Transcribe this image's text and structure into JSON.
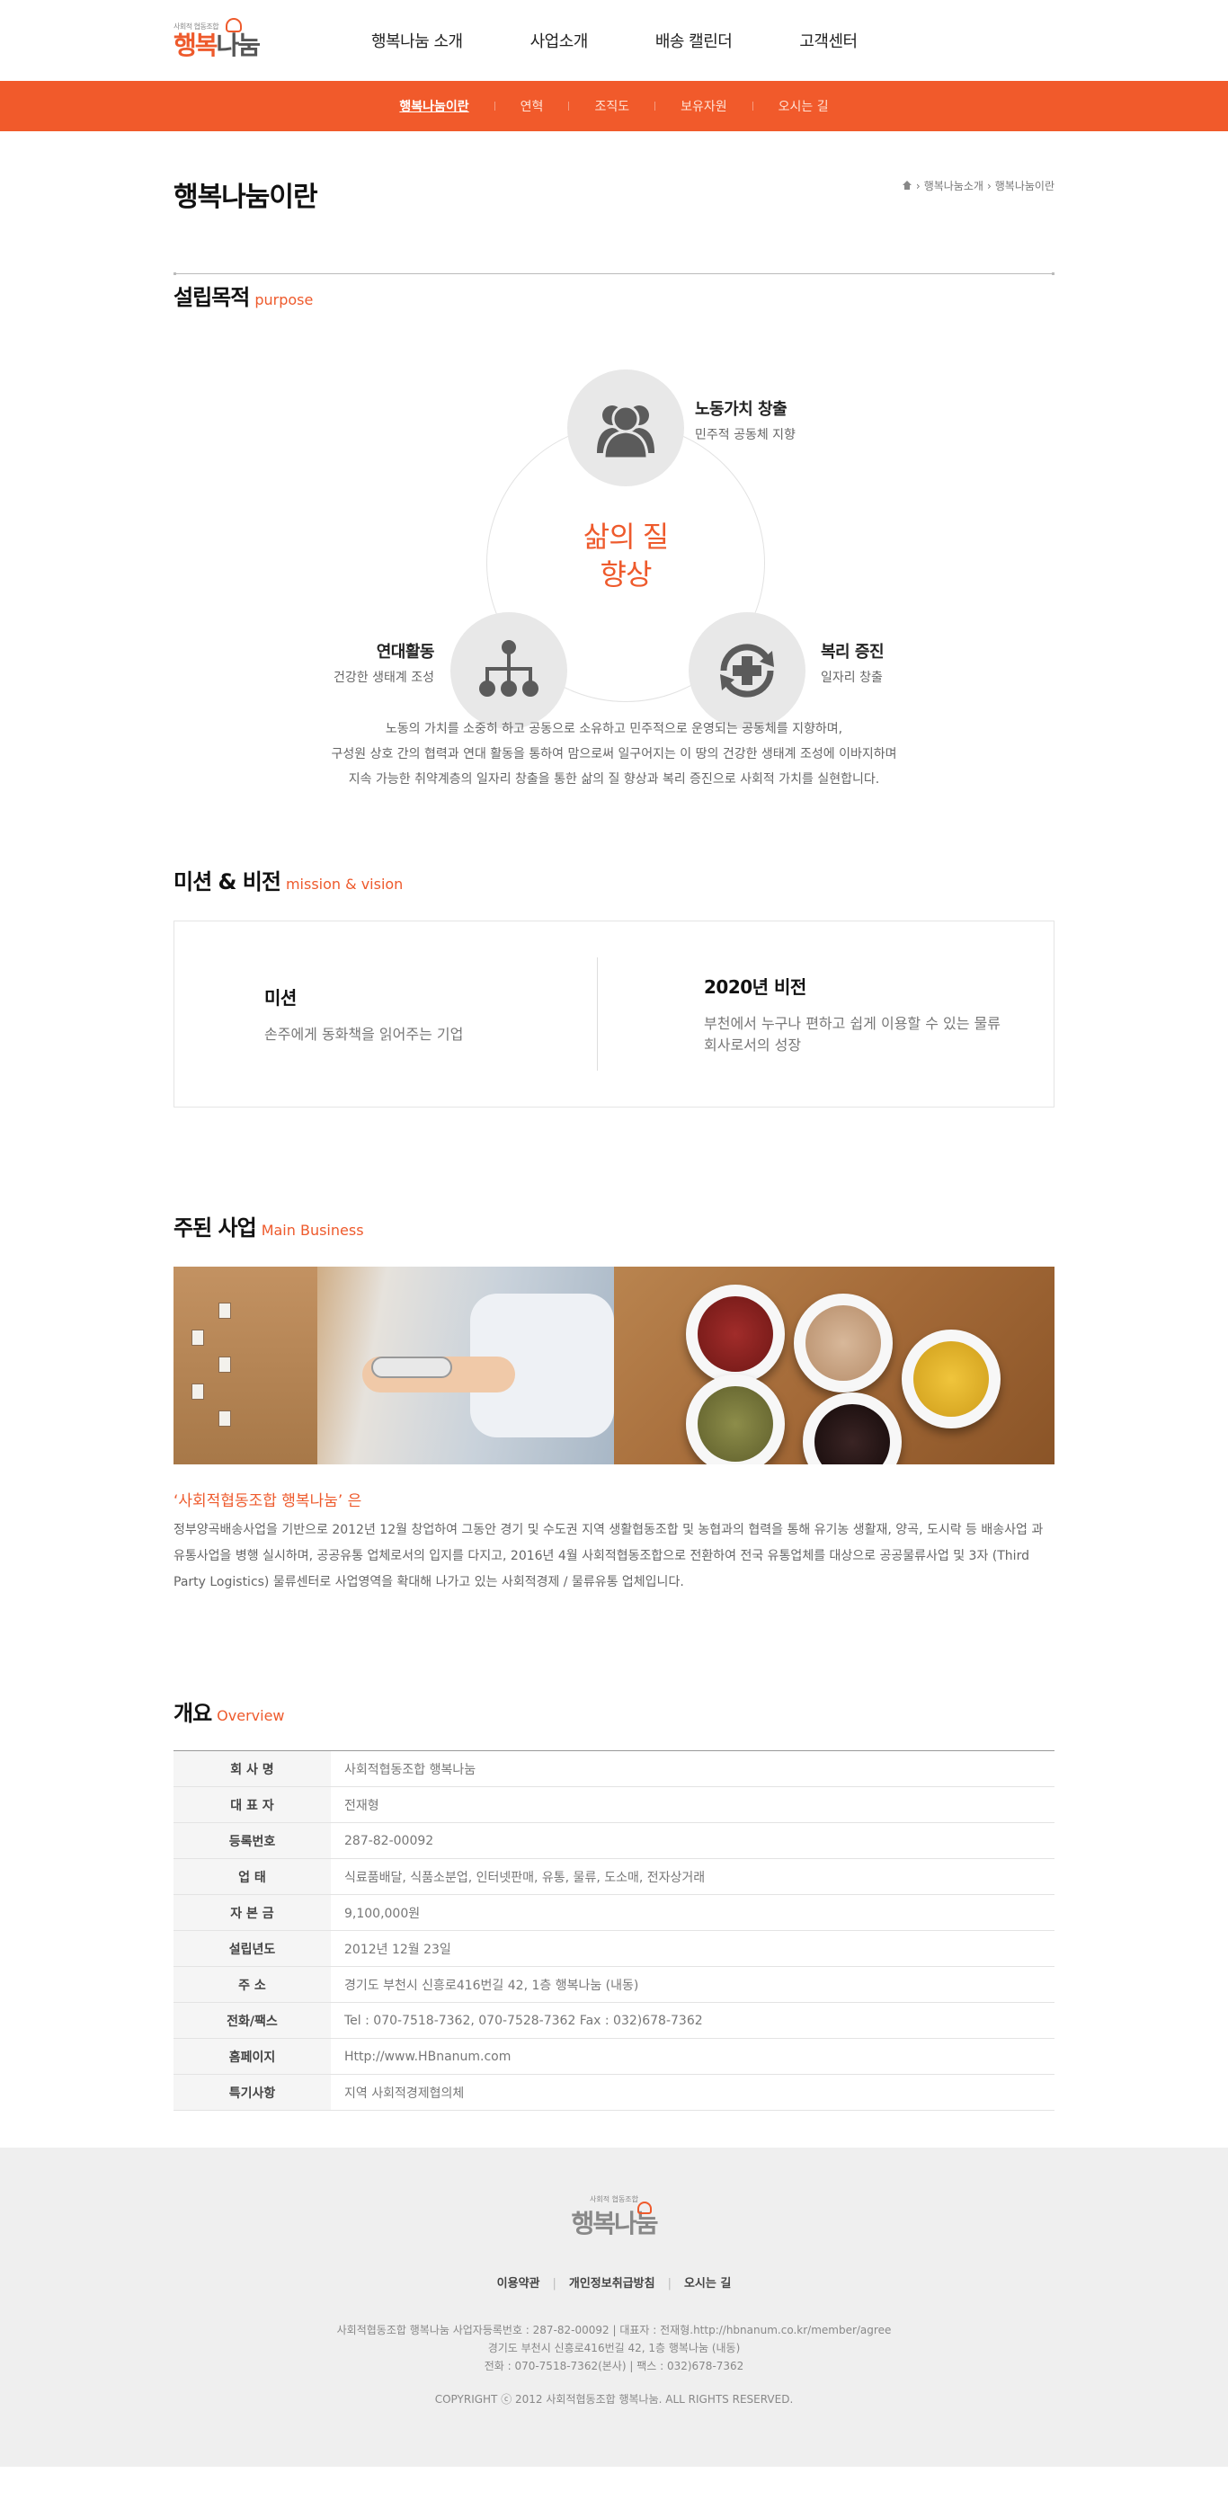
{
  "header": {
    "logo_small": "사회적 협동조합",
    "logo_main": "행복",
    "logo_main2": "나눔",
    "nav": [
      "행복나눔 소개",
      "사업소개",
      "배송 캘린더",
      "고객센터"
    ]
  },
  "subnav": [
    "행복나눔이란",
    "연혁",
    "조직도",
    "보유자원",
    "오시는 길"
  ],
  "page": {
    "title": "행복나눔이란",
    "breadcrumb": [
      "행복나눔소개",
      "행복나눔이란"
    ]
  },
  "purpose": {
    "heading": "설립목적",
    "heading_en": "purpose",
    "center_line1": "삶의 질",
    "center_line2": "향상",
    "nodes": [
      {
        "title": "노동가치 창출",
        "sub": "민주적 공동체 지향",
        "icon": "people-icon"
      },
      {
        "title": "연대활동",
        "sub": "건강한 생태계 조성",
        "icon": "org-chart-icon"
      },
      {
        "title": "복리 증진",
        "sub": "일자리 창출",
        "icon": "medical-cross-icon"
      }
    ],
    "desc": [
      "노동의 가치를 소중히 하고 공동으로 소유하고 민주적으로 운영되는 공동체를 지향하며,",
      "구성원 상호 간의 협력과 연대 활동을 통하여 맘으로써 일구어지는 이 땅의 건강한 생태계 조성에 이바지하며",
      "지속 가능한 취약계층의 일자리 창출을 통한 삶의 질 향상과 복리 증진으로 사회적 가치를 실현합니다."
    ]
  },
  "mission": {
    "heading": "미션 & 비전",
    "heading_en": "mission & vision",
    "mission_title": "미션",
    "mission_desc": "손주에게 동화책을 읽어주는 기업",
    "vision_title": "2020년 비전",
    "vision_desc": "부천에서 누구나 편하고 쉽게 이용할 수 있는 물류회사로서의 성장"
  },
  "business": {
    "heading": "주된 사업",
    "heading_en": "Main Business",
    "title": "‘사회적협동조합 행복나눔’ 은",
    "desc": "정부양곡배송사업을 기반으로 2012년 12월 창업하여 그동안 경기 및 수도권 지역 생활협동조합 및 농협과의 협력을 통해 유기농 생활재, 양곡, 도시락 등 배송사업 과 유통사업을 병행 실시하며, 공공유통 업체로서의 입지를 다지고, 2016년 4월 사회적협동조합으로 전환하여 전국 유통업체를 대상으로 공공물류사업 및 3자 (Third Party Logistics) 물류센터로 사업영역을 확대해 나가고 있는 사회적경제 / 물류유통 업체입니다."
  },
  "overview": {
    "heading": "개요",
    "heading_en": "Overview",
    "rows": [
      {
        "k": "회 사 명",
        "v": "사회적협동조합 행복나눔"
      },
      {
        "k": "대 표 자",
        "v": "전재형"
      },
      {
        "k": "등록번호",
        "v": "287-82-00092"
      },
      {
        "k": "업 태",
        "v": "식료품배달, 식품소분업, 인터넷판매, 유통, 물류, 도소매, 전자상거래"
      },
      {
        "k": "자 본 금",
        "v": "9,100,000원"
      },
      {
        "k": "설립년도",
        "v": "2012년 12월 23일"
      },
      {
        "k": "주 소",
        "v": "경기도 부천시 신흥로416번길 42, 1층 행복나눔 (내동)"
      },
      {
        "k": "전화/팩스",
        "v": "Tel : 070-7518-7362, 070-7528-7362 Fax : 032)678-7362"
      },
      {
        "k": "홈페이지",
        "v": "Http://www.HBnanum.com"
      },
      {
        "k": "특기사항",
        "v": "지역 사회적경제협의체"
      }
    ]
  },
  "footer": {
    "logo_small": "사회적 협동조합",
    "logo_main": "행복나눔",
    "links": [
      "이용약관",
      "개인정보취급방침",
      "오시는 길"
    ],
    "info": [
      "사회적협동조합 행복나눔 사업자등록번호 : 287-82-00092    |    대표자 : 전재형.http://hbnanum.co.kr/member/agree",
      "경기도 부천시 신흥로416번길 42, 1층 행복나눔 (내동)",
      "전화 : 070-7518-7362(본사)    |    팩스 : 032)678-7362"
    ],
    "copyright": "COPYRIGHT ⓒ 2012 사회적협동조합 행복나눔. ALL RIGHTS RESERVED."
  },
  "colors": {
    "accent": "#f15a2b",
    "footer_bg": "#efefef"
  }
}
